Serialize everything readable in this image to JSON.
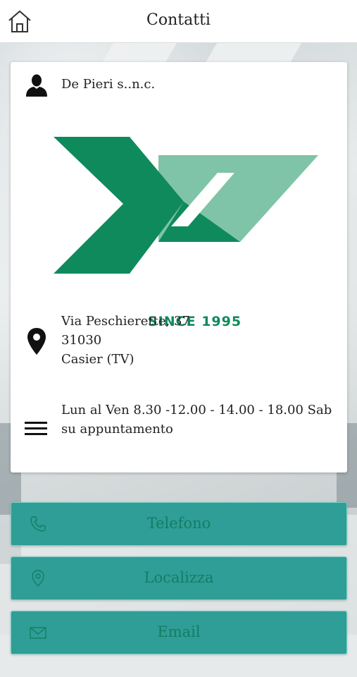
{
  "header": {
    "title": "Contatti",
    "home_icon": "home-icon"
  },
  "card": {
    "company": {
      "icon": "person-icon",
      "name": "De Pieri s..n.c."
    },
    "logo": {
      "tagline": "SINCE 1995",
      "color": "#0f8a5c",
      "light_color": "#7fc4a8"
    },
    "address": {
      "icon": "map-pin-icon",
      "line1": "Via Peschierette, 37",
      "line2": "31030",
      "line3": "Casier (TV)"
    },
    "hours": {
      "icon": "menu-lines-icon",
      "text": "Lun al Ven 8.30 -12.00 - 14.00 - 18.00 Sab su appuntamento"
    }
  },
  "actions": [
    {
      "label": "Telefono",
      "icon": "phone-icon"
    },
    {
      "label": "Localizza",
      "icon": "location-icon"
    },
    {
      "label": "Email",
      "icon": "email-icon"
    }
  ],
  "colors": {
    "button_bg": "#2e9e96",
    "button_text": "#147d64"
  }
}
